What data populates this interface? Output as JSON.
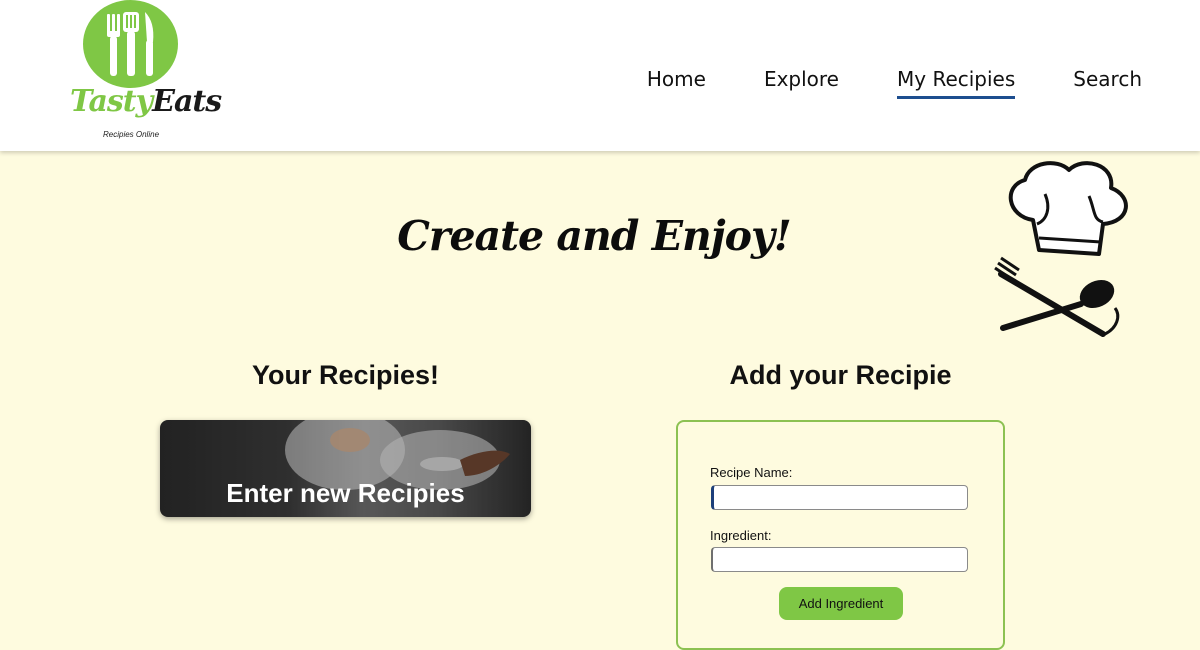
{
  "brand": {
    "name_part1": "Tasty",
    "name_part2": "Eats",
    "tagline": "Recipies Online",
    "green": "#7fc745",
    "icon": "cutlery-logo-icon"
  },
  "nav": {
    "items": [
      {
        "label": "Home",
        "active": false
      },
      {
        "label": "Explore",
        "active": false
      },
      {
        "label": "My Recipies",
        "active": true
      },
      {
        "label": "Search",
        "active": false
      }
    ],
    "active_underline_color": "#1d4e8f"
  },
  "hero": {
    "title": "Create and Enjoy!",
    "decoration": "chef-hat-fork-spoon-icon"
  },
  "your_recipes": {
    "heading": "Your Recipies!",
    "card_label": "Enter new Recipies"
  },
  "add_recipe": {
    "heading": "Add your Recipie",
    "recipe_name_label": "Recipe Name:",
    "recipe_name_value": "",
    "ingredient_label": "Ingredient:",
    "ingredient_value": "",
    "add_button_label": "Add Ingredient"
  },
  "colors": {
    "page_background": "#fefbdf",
    "form_border": "#8cc152"
  }
}
